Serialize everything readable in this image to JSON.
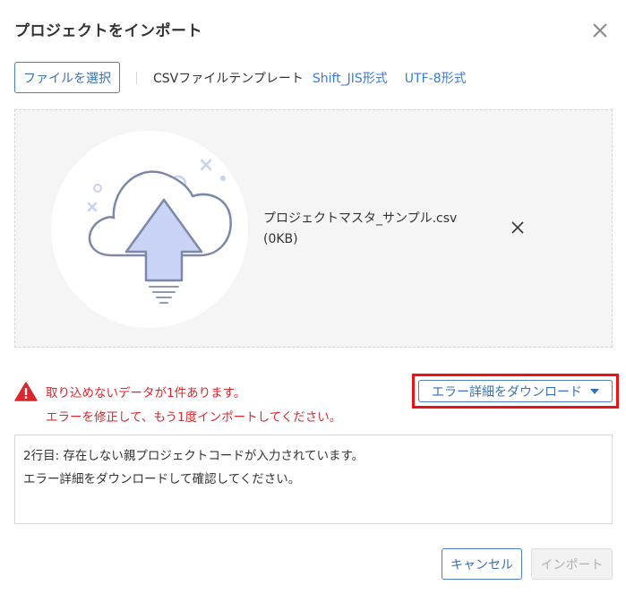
{
  "dialog": {
    "title": "プロジェクトをインポート",
    "close_icon": "close-icon"
  },
  "toolbar": {
    "select_file_label": "ファイルを選択",
    "template_label": "CSVファイルテンプレート",
    "template_links": [
      "Shift_JIS形式",
      "UTF-8形式"
    ]
  },
  "upload": {
    "icon": "cloud-upload-icon",
    "file_name": "プロジェクトマスタ_サンプル.csv",
    "file_size": "(0KB)",
    "remove_icon": "close-icon"
  },
  "error": {
    "icon": "warning-icon",
    "line1": "取り込めないデータが1件あります。",
    "line2": "エラーを修正して、もう1度インポートしてください。",
    "download_label": "エラー詳細をダウンロード",
    "detail_lines": [
      "2行目: 存在しない親プロジェクトコードが入力されています。",
      "エラー詳細をダウンロードして確認してください。"
    ]
  },
  "footer": {
    "cancel_label": "キャンセル",
    "import_label": "インポート",
    "import_enabled": false
  },
  "colors": {
    "accent": "#3a7bd5",
    "error": "#d9272e",
    "highlight": "#ee1111",
    "cloud_fill": "#c8d3f5",
    "cloud_stroke": "#7d88a8"
  }
}
